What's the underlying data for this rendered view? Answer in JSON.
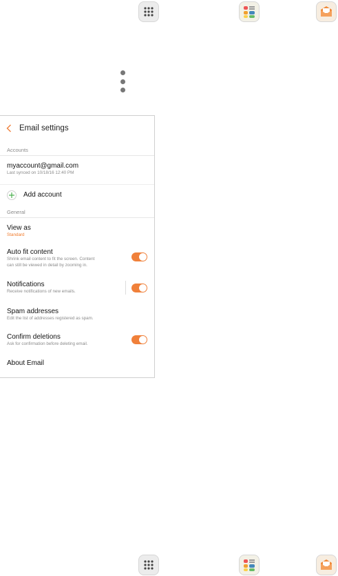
{
  "screen": {
    "title": "Email settings",
    "sections": {
      "accounts": "Accounts",
      "general": "General"
    },
    "account": {
      "email": "myaccount@gmail.com",
      "synced": "Last synced on 10/18/16  12:40 PM"
    },
    "add_account": "Add account",
    "view_as": {
      "title": "View as",
      "value": "Standard"
    },
    "auto_fit": {
      "title": "Auto fit content",
      "sub_line1": "Shrink email content to fit the screen. Content",
      "sub_line2": "can still be viewed in detail by zooming in.",
      "on": true
    },
    "notifications": {
      "title": "Notifications",
      "sub": "Receive notifications of new emails.",
      "on": true
    },
    "spam": {
      "title": "Spam addresses",
      "sub": "Edit the list of addresses registered as spam."
    },
    "confirm": {
      "title": "Confirm deletions",
      "sub": "Ask for confirmation before deleting email.",
      "on": true
    },
    "about": "About Email"
  },
  "icons": {
    "top": [
      "apps-grid-icon",
      "app-folder-icon",
      "email-app-icon"
    ],
    "bottom": [
      "apps-grid-icon",
      "app-folder-icon",
      "email-app-icon"
    ],
    "overflow": "more-options-icon"
  },
  "colors": {
    "accent": "#f0803a",
    "add_plus": "#4caf50",
    "secondary_text": "#8a8a8a"
  }
}
